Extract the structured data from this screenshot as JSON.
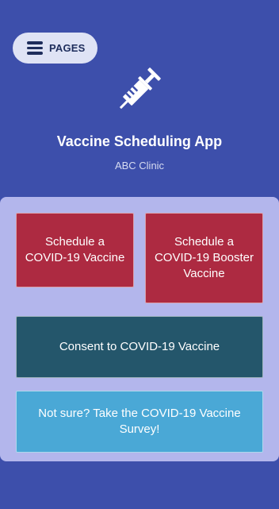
{
  "header": {
    "pages_label": "PAGES",
    "app_icon": "syringe-icon",
    "title": "Vaccine Scheduling App",
    "subtitle": "ABC Clinic"
  },
  "tiles": [
    {
      "label": "Schedule a COVID-19 Vaccine",
      "color": "#ad2a41"
    },
    {
      "label": "Schedule a COVID-19 Booster Vaccine",
      "color": "#ad2a41"
    },
    {
      "label": "Consent to COVID-19 Vaccine",
      "color": "#24566b"
    },
    {
      "label": "Not sure? Take the COVID-19 Vaccine Survey!",
      "color": "#4aa8d6"
    }
  ],
  "colors": {
    "background": "#3d4fab",
    "panel": "#b3b6ec",
    "pages_button": "#dfe3f5"
  }
}
